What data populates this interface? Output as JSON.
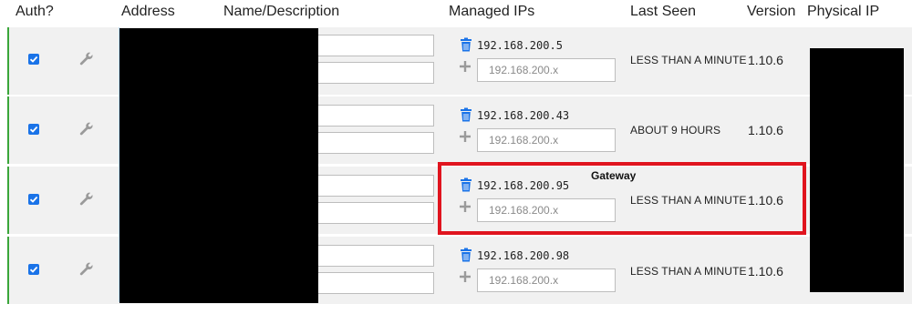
{
  "columns": {
    "auth": "Auth?",
    "address": "Address",
    "name": "Name/Description",
    "managed_ips": "Managed IPs",
    "last_seen": "Last Seen",
    "version": "Version",
    "physical_ip": "Physical IP"
  },
  "colors": {
    "row_background": "#f1f1f1",
    "authorized_border": "#3aa63a",
    "checkbox_accent": "#1a73e8",
    "trash_icon": "#1a73e8",
    "highlight_box": "#e0141e",
    "redaction": "#000000"
  },
  "icons": {
    "edit": "wrench-icon",
    "delete_ip": "trash-icon",
    "add_ip": "plus-icon",
    "auth": "checkbox-checked-icon"
  },
  "rows": [
    {
      "authorized": true,
      "managed_ip": "192.168.200.5",
      "new_ip_placeholder": "192.168.200.x",
      "last_seen": "LESS THAN A MINUTE",
      "version": "1.10.6"
    },
    {
      "authorized": true,
      "managed_ip": "192.168.200.43",
      "new_ip_placeholder": "192.168.200.x",
      "last_seen": "ABOUT 9 HOURS",
      "version": "1.10.6"
    },
    {
      "authorized": true,
      "managed_ip": "192.168.200.95",
      "new_ip_placeholder": "192.168.200.x",
      "last_seen": "LESS THAN A MINUTE",
      "version": "1.10.6"
    },
    {
      "authorized": true,
      "managed_ip": "192.168.200.98",
      "new_ip_placeholder": "192.168.200.x",
      "last_seen": "LESS THAN A MINUTE",
      "version": "1.10.6"
    }
  ],
  "annotation": {
    "label": "Gateway"
  }
}
